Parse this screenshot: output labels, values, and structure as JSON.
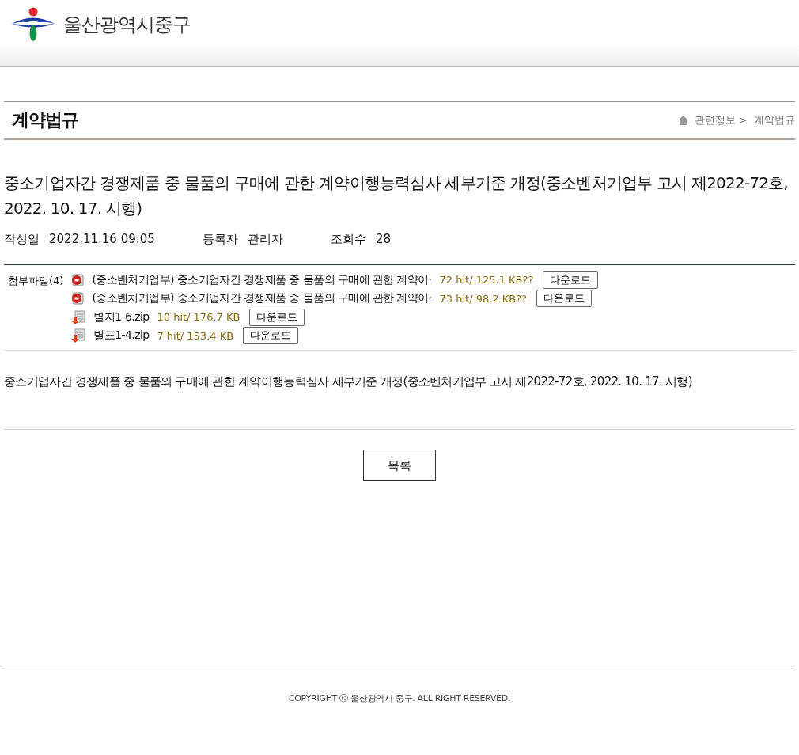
{
  "header": {
    "site_name": "울산광역시중구"
  },
  "section": {
    "title": "계약법규",
    "breadcrumb": [
      "관련정보 >",
      "계약법규"
    ]
  },
  "post": {
    "title": "중소기업자간 경쟁제품 중 물품의 구매에 관한 계약이행능력심사 세부기준 개정(중소벤처기업부 고시 제2022-72호, 2022. 10. 17. 시행)",
    "meta": [
      {
        "label": "작성일",
        "value": "2022.11.16 09:05"
      },
      {
        "label": "등록자",
        "value": "관리자"
      },
      {
        "label": "조회수",
        "value": "28"
      }
    ],
    "attachments_label": "첨부파일(4)",
    "attachments": [
      {
        "kind": "hwp",
        "name": "(중소벤처기업부) 중소기업자간 경쟁제품 중 물품의 구매에 관한 계약이·",
        "info": "72 hit/ 125.1 KB??",
        "button": "다운로드"
      },
      {
        "kind": "hwp",
        "name": "(중소벤처기업부) 중소기업자간 경쟁제품 중 물품의 구매에 관한 계약이·",
        "info": "73 hit/ 98.2 KB??",
        "button": "다운로드"
      },
      {
        "kind": "zip",
        "name": "별지1-6.zip",
        "info": "10 hit/ 176.7 KB",
        "button": "다운로드"
      },
      {
        "kind": "zip",
        "name": "별표1-4.zip",
        "info": "7 hit/ 153.4 KB",
        "button": "다운로드"
      }
    ],
    "body": "중소기업자간 경쟁제품 중 물품의 구매에 관한 계약이행능력심사 세부기준 개정(중소벤처기업부 고시 제2022-72호, 2022. 10. 17. 시행)",
    "list_button": "목록"
  },
  "footer": {
    "copyright": "COPYRIGHT ⓒ 울산광역시 중구. ALL RIGHT RESERVED."
  }
}
